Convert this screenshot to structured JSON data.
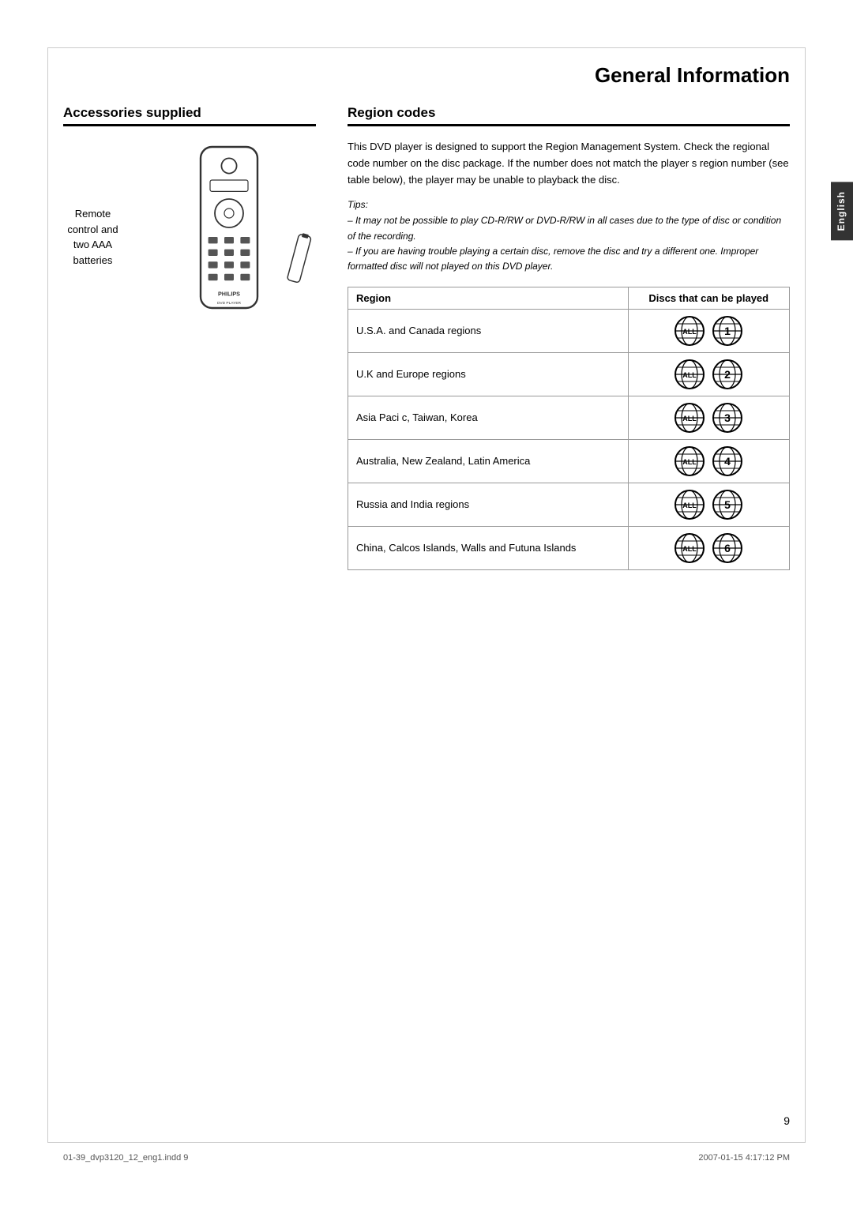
{
  "page": {
    "title": "General Information",
    "number": "9",
    "footer_left": "01-39_dvp3120_12_eng1.indd 9",
    "footer_right": "2007-01-15  4:17:12 PM",
    "language_tab": "English"
  },
  "accessories": {
    "heading": "Accessories supplied",
    "label_line1": "Remote",
    "label_line2": "control and",
    "label_line3": "two AAA",
    "label_line4": "batteries"
  },
  "region_codes": {
    "heading": "Region codes",
    "description": "This DVD player is designed to support the Region Management System. Check the regional code number on the disc package. If the number does not match the player s region number (see table below), the player may be unable to playback the disc.",
    "tips_title": "Tips:",
    "tips_lines": [
      "– It may not be possible to play CD-R/RW or DVD-R/RW in all cases due to the type of disc or condition of the recording.",
      "– If you are having trouble playing a certain disc, remove the disc and try a different one. Improper formatted disc will not played on this DVD player."
    ],
    "table": {
      "col1_header": "Region",
      "col2_header": "Discs that can be played",
      "rows": [
        {
          "region": "U.S.A. and Canada regions",
          "number": "1"
        },
        {
          "region": "U.K and Europe regions",
          "number": "2"
        },
        {
          "region": "Asia Paci c, Taiwan, Korea",
          "number": "3"
        },
        {
          "region": "Australia, New Zealand, Latin America",
          "number": "4"
        },
        {
          "region": "Russia and India regions",
          "number": "5"
        },
        {
          "region": "China, Calcos Islands, Walls and Futuna Islands",
          "number": "6"
        }
      ]
    }
  }
}
